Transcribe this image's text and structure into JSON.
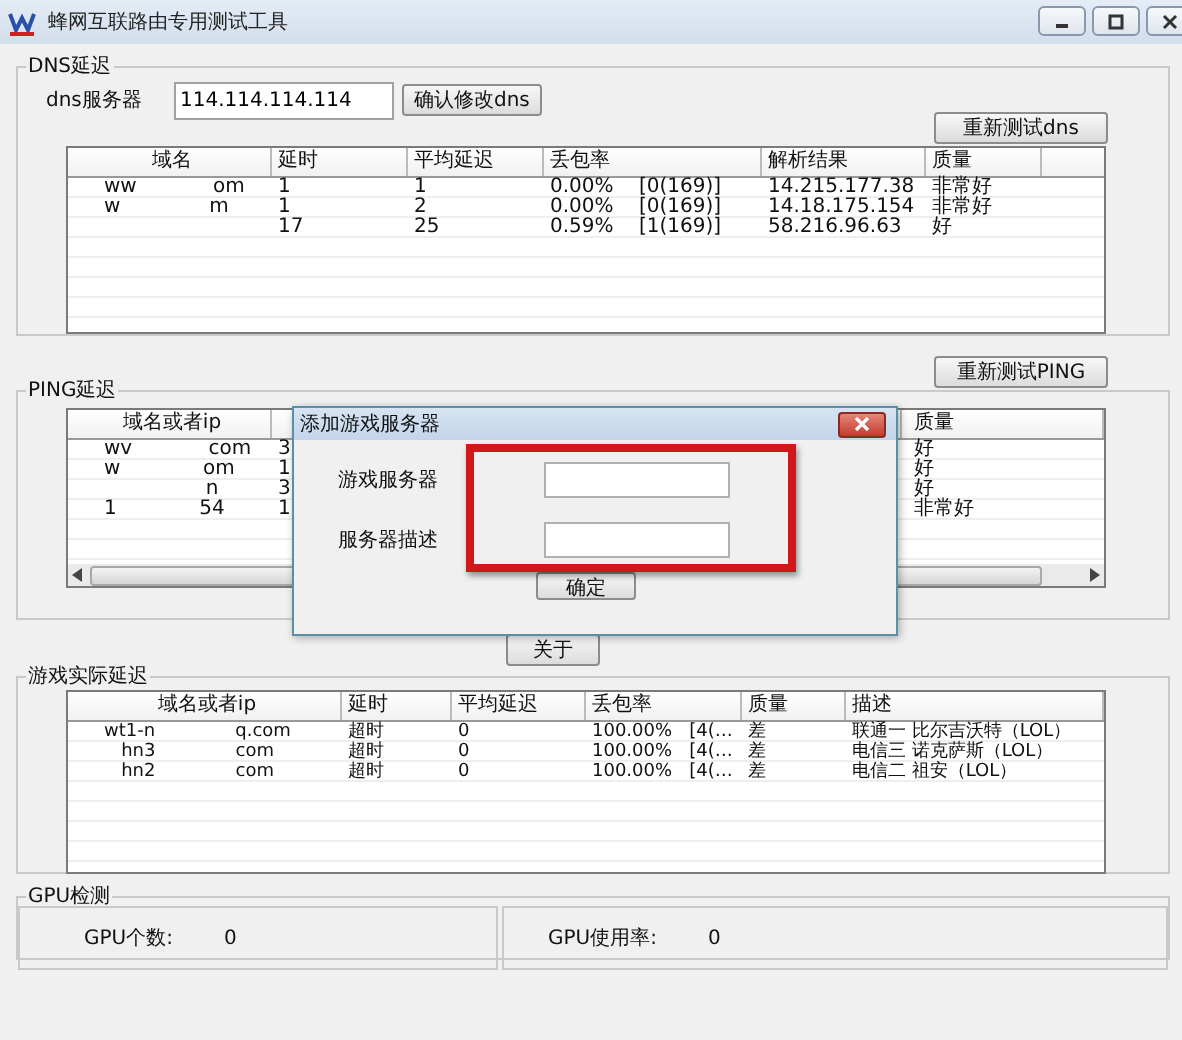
{
  "window": {
    "title": "蜂网互联路由专用测试工具"
  },
  "dns": {
    "legend": "DNS延迟",
    "server_label": "dns服务器",
    "server_value": "114.114.114.114",
    "confirm_button": "确认修改dns",
    "retest_button": "重新测试dns",
    "columns": [
      "域名",
      "延时",
      "平均延迟",
      "丢包率",
      "解析结果",
      "质量"
    ],
    "rows": [
      {
        "cells": [
          "ww            om",
          "1",
          "1",
          "0.00%    [0(169)]",
          "14.215.177.38",
          "非常好"
        ]
      },
      {
        "cells": [
          "w              m",
          "1",
          "2",
          "0.00%    [0(169)]",
          "14.18.175.154",
          "非常好"
        ]
      },
      {
        "cells": [
          "",
          "17",
          "25",
          "0.59%    [1(169)]",
          "58.216.96.63",
          "好"
        ]
      }
    ]
  },
  "ping": {
    "legend": "PING延迟",
    "retest_button": "重新测试PING",
    "domain_header": "域名或者ip",
    "quality_header": "质量",
    "rows": [
      {
        "domain": "wv            com",
        "delay": "3",
        "quality": "好"
      },
      {
        "domain": "w             om",
        "delay": "1",
        "quality": "好"
      },
      {
        "domain": "                n",
        "delay": "3",
        "quality": "好"
      },
      {
        "domain": "1             54",
        "delay": "1",
        "quality": "非常好"
      }
    ]
  },
  "dialog": {
    "title": "添加游戏服务器",
    "server_label": "游戏服务器",
    "desc_label": "服务器描述",
    "ok_button": "确定"
  },
  "about_button": "关于",
  "game": {
    "legend": "游戏实际延迟",
    "columns": [
      "域名或者ip",
      "延时",
      "平均延迟",
      "丢包率",
      "质量",
      "描述"
    ],
    "rows": [
      {
        "cells": [
          "wt1-n              q.com",
          "超时",
          "0",
          "100.00%   [4(…",
          "差",
          "联通一 比尔吉沃特（LOL）"
        ]
      },
      {
        "cells": [
          "   hn3              com",
          "超时",
          "0",
          "100.00%   [4(…",
          "差",
          "电信三 诺克萨斯（LOL）"
        ]
      },
      {
        "cells": [
          "   hn2              com",
          "超时",
          "0",
          "100.00%   [4(…",
          "差",
          "电信二 祖安（LOL）"
        ]
      }
    ]
  },
  "gpu": {
    "legend": "GPU检测",
    "count_label": "GPU个数:",
    "count_value": "0",
    "usage_label": "GPU使用率:",
    "usage_value": "0"
  }
}
